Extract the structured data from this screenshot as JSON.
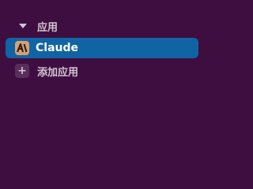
{
  "sidebar": {
    "section": {
      "title": "应用",
      "caret_icon": "caret-down-icon"
    },
    "apps": [
      {
        "name": "Claude",
        "icon": "claude-app-icon",
        "selected": true
      }
    ],
    "add_app": {
      "icon": "plus-icon",
      "label": "添加应用"
    }
  },
  "colors": {
    "background": "#3f0e40",
    "selected_item": "#1164a3",
    "text": "#d1c4d2",
    "selected_text": "#ffffff",
    "app_icon_bg": "#d5a174",
    "add_icon_bg": "#5a2d5b"
  }
}
